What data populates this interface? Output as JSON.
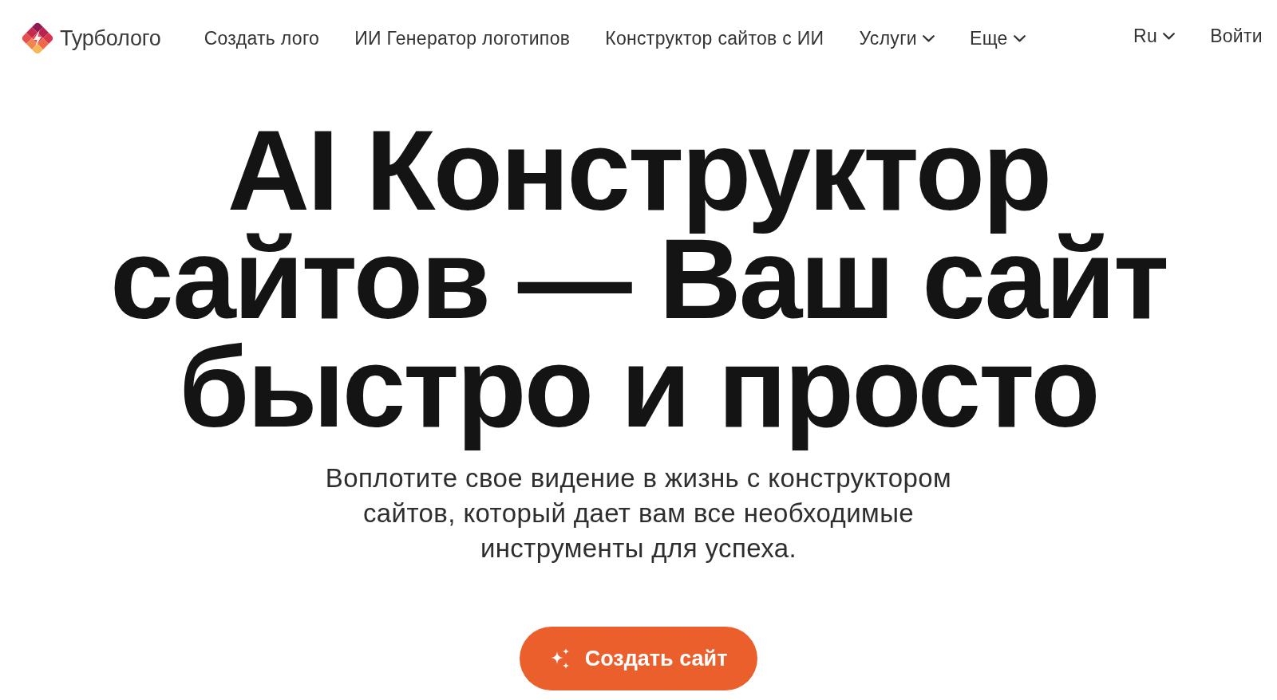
{
  "header": {
    "logo": {
      "name": "Турболого"
    },
    "nav": [
      {
        "label": "Создать лого",
        "has_menu": false
      },
      {
        "label": "ИИ Генератор логотипов",
        "has_menu": false
      },
      {
        "label": "Конструктор сайтов с ИИ",
        "has_menu": false
      },
      {
        "label": "Услуги",
        "has_menu": true
      },
      {
        "label": "Еще",
        "has_menu": true
      }
    ],
    "language": {
      "label": "Ru",
      "has_menu": true
    },
    "login": {
      "label": "Войти"
    }
  },
  "hero": {
    "title": "AI Конструктор сайтов — Ваш сайт быстро и просто",
    "subtitle": "Воплотите свое видение в жизнь с конструктором сайтов, который дает вам все необходимые инструменты для успеха.",
    "cta": {
      "label": "Создать сайт"
    }
  }
}
